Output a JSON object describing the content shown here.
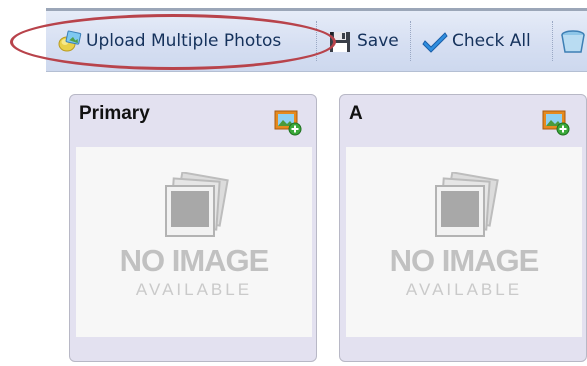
{
  "toolbar": {
    "upload_label": "Upload Multiple Photos",
    "save_label": "Save",
    "check_all_label": "Check All",
    "icons": {
      "upload": "upload-photos-icon",
      "save": "floppy-disk-icon",
      "check_all": "checkmark-icon",
      "next": "trash-icon"
    }
  },
  "annotation": {
    "color": "#b8434b",
    "target": "upload-multiple-photos-button"
  },
  "cards": [
    {
      "title": "Primary",
      "placeholder_line1": "NO IMAGE",
      "placeholder_line2": "AVAILABLE"
    },
    {
      "title": "A",
      "placeholder_line1": "NO IMAGE",
      "placeholder_line2": "AVAILABLE"
    }
  ],
  "colors": {
    "toolbar_bg": "#d6dff2",
    "toolbar_text": "#15325c",
    "card_bg": "#e3e1f0",
    "placeholder_text": "#c1c1c1"
  }
}
